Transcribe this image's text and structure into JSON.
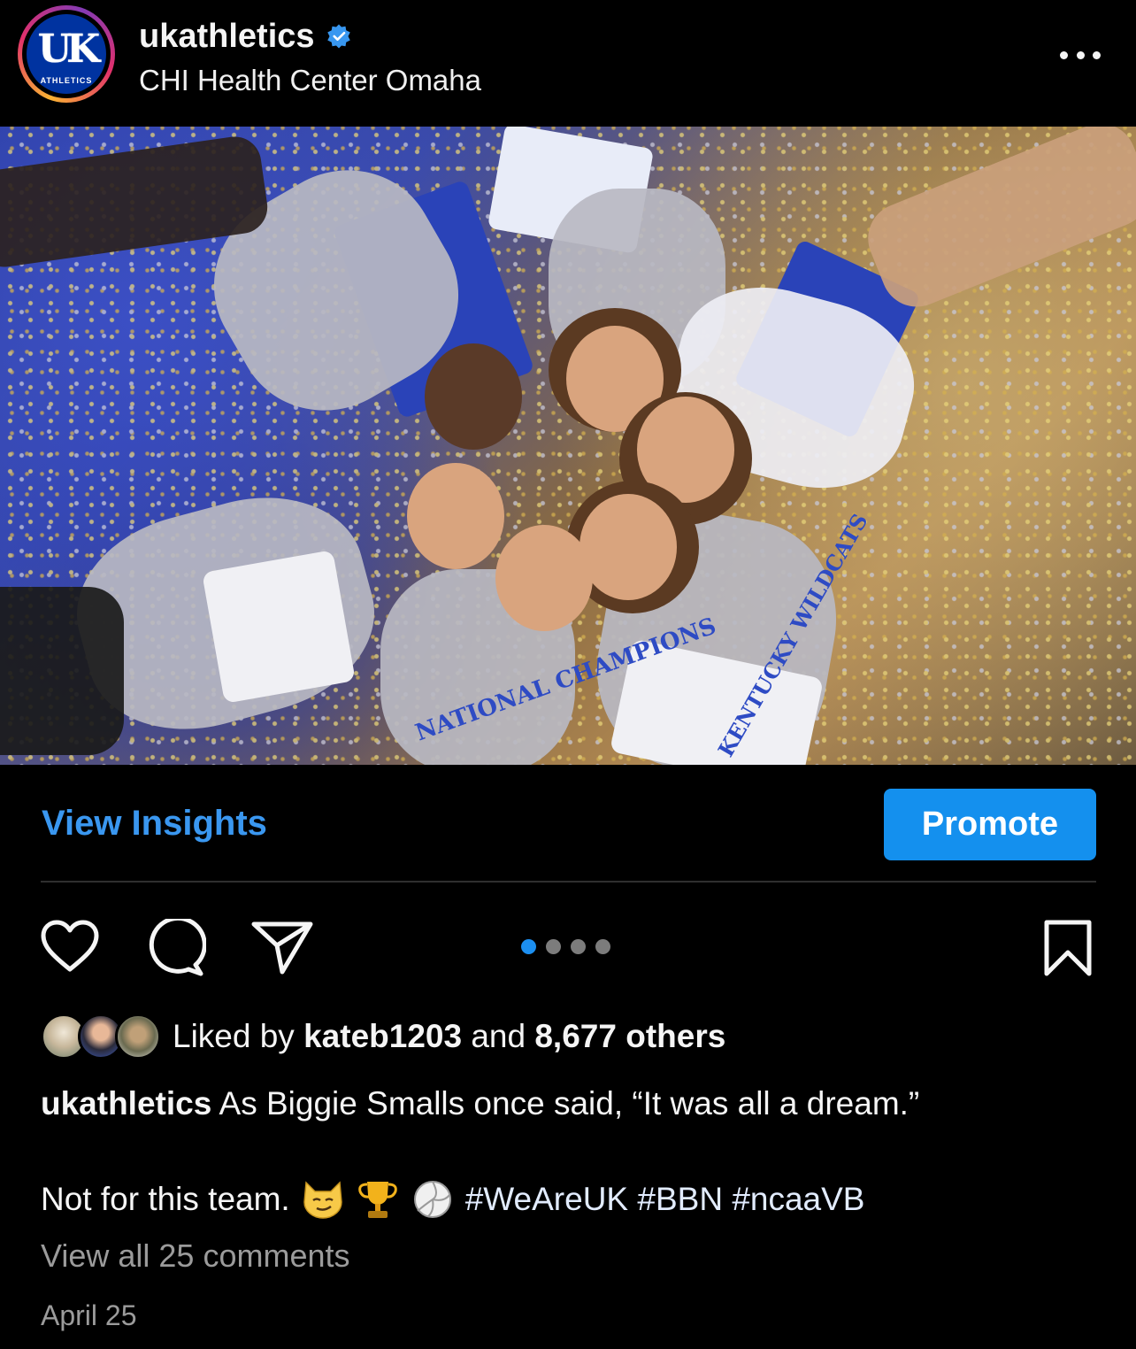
{
  "header": {
    "username": "ukathletics",
    "location": "CHI Health Center Omaha",
    "avatar_text": "UK",
    "avatar_subtext": "ATHLETICS",
    "verified_color": "#3897f0"
  },
  "photo": {
    "shirt_text": "NATIONAL CHAMPIONS",
    "shirt_subtext": "KENTUCKY WILDCATS"
  },
  "insights": {
    "view_insights_label": "View Insights",
    "promote_label": "Promote",
    "accent_color": "#1490ee"
  },
  "actions": {
    "icons": [
      "heart-icon",
      "comment-icon",
      "share-icon",
      "bookmark-icon"
    ],
    "carousel_total": 4,
    "carousel_active": 1
  },
  "likes": {
    "prefix": "Liked by",
    "liker": "kateb1203",
    "joiner": "and",
    "others": "8,677 others"
  },
  "caption": {
    "username": "ukathletics",
    "text": "As Biggie Smalls once said, “It was all a dream.”",
    "line2": "Not for this team.",
    "emojis": [
      "smirking-cat-emoji",
      "trophy-emoji",
      "volleyball-emoji"
    ],
    "hashtags": "#WeAreUK #BBN #ncaaVB"
  },
  "comments_label": "View all 25 comments",
  "date": "April 25"
}
